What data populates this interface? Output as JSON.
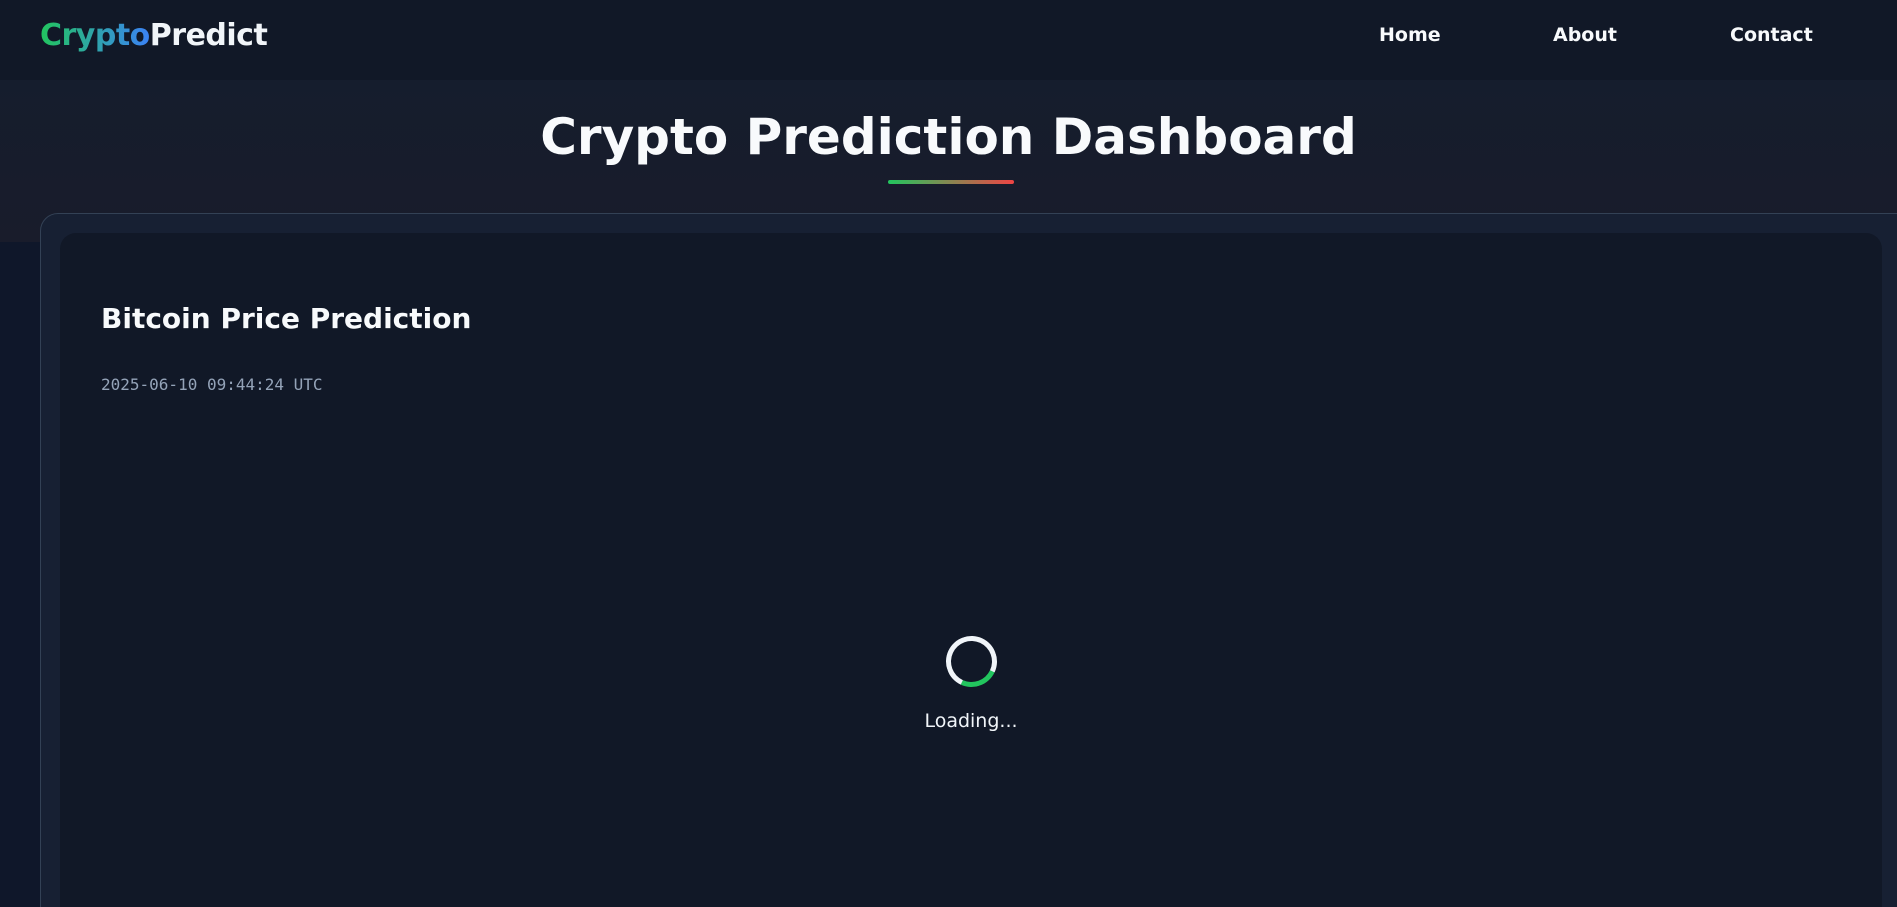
{
  "nav": {
    "logo_part1": "Crypto",
    "logo_part2": "Predict",
    "links": [
      "Home",
      "About",
      "Contact"
    ]
  },
  "page_title": "Crypto Prediction Dashboard",
  "card": {
    "title": "Bitcoin Price Prediction",
    "timestamp": "2025-06-10 09:44:24 UTC",
    "loading_text": "Loading..."
  },
  "colors": {
    "accent_green": "#22c55e",
    "accent_red": "#ef4444",
    "background": "#0f172a"
  }
}
